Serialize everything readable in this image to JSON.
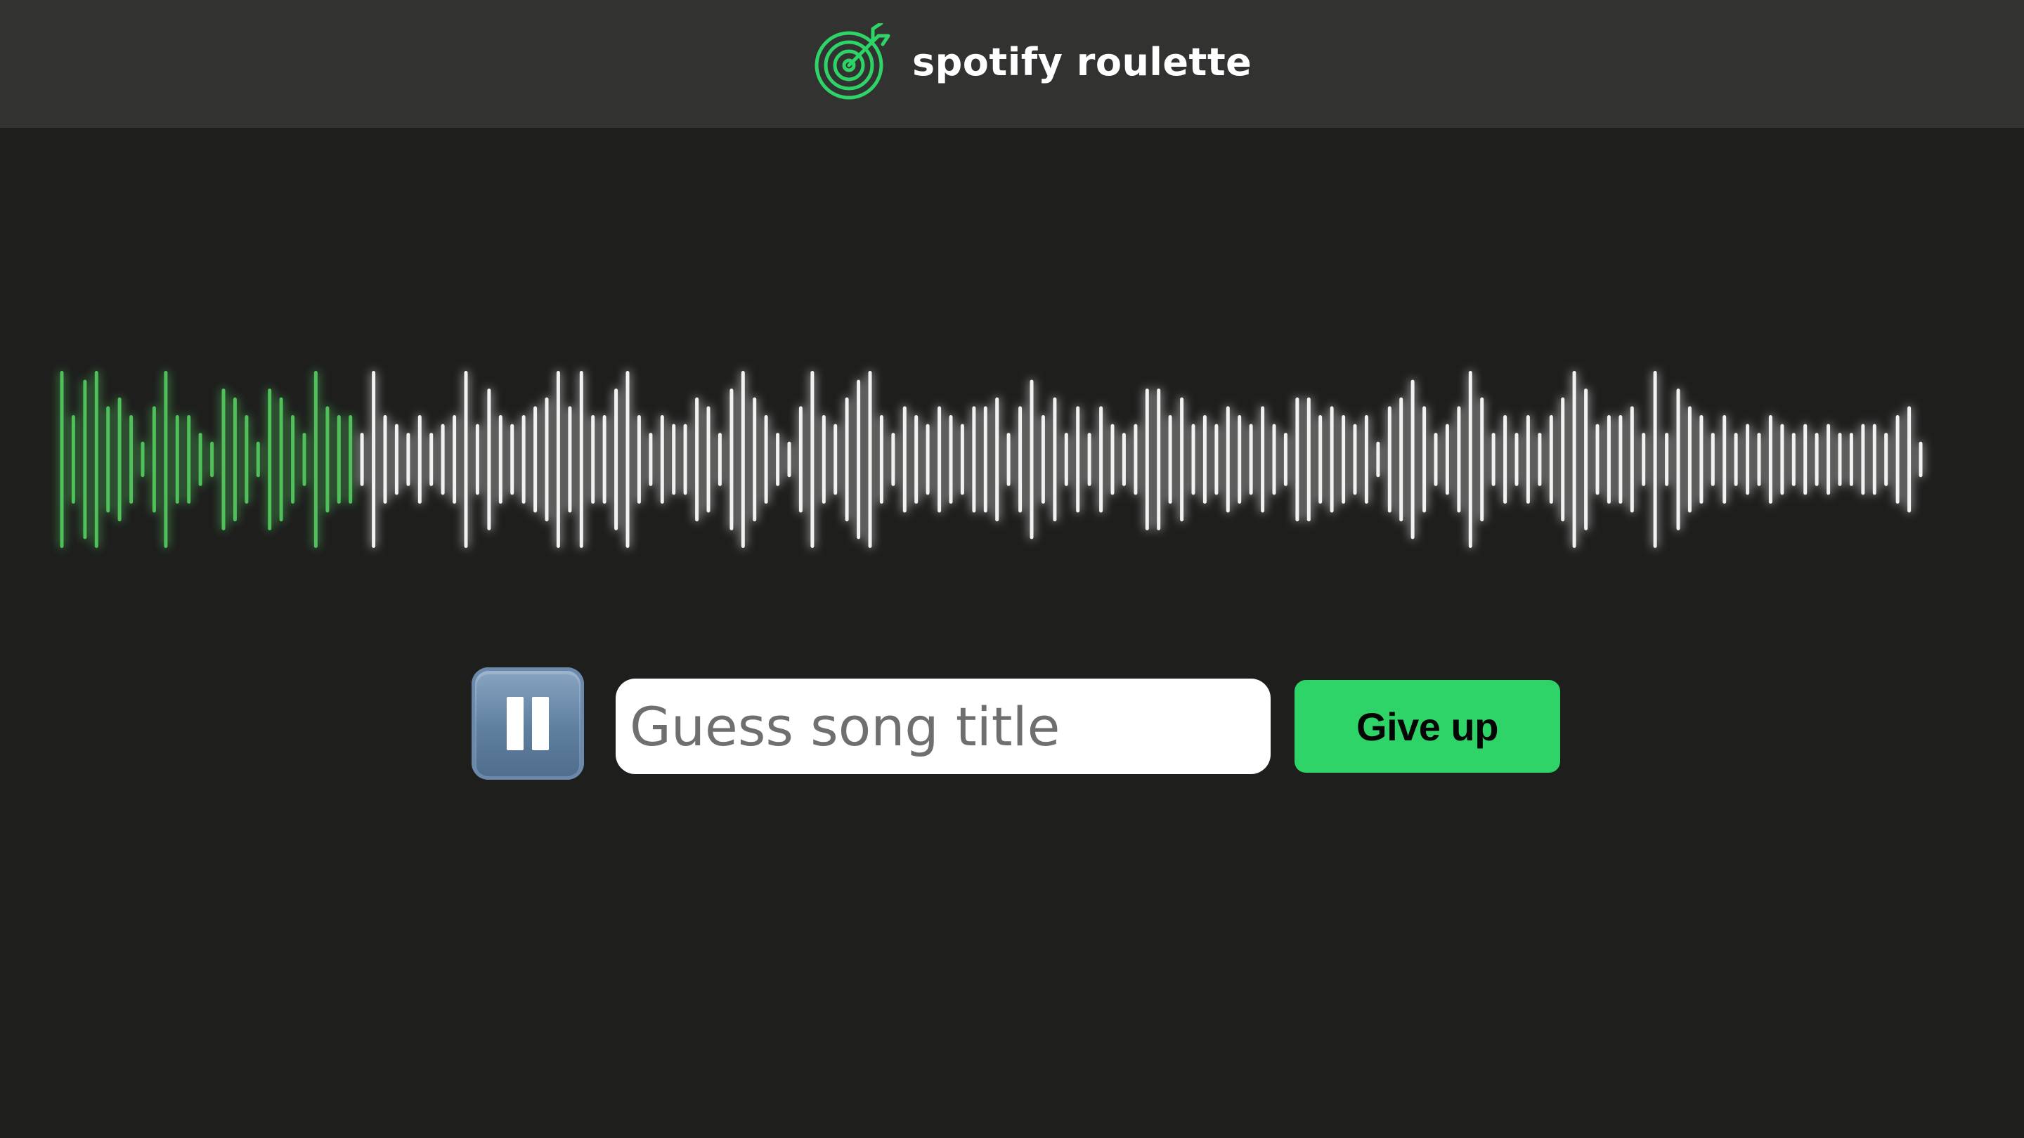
{
  "header": {
    "title": "spotify roulette",
    "logo_icon": "target-arrow-icon",
    "accent_color": "#2ed467"
  },
  "waveform": {
    "played_fraction": 0.16,
    "played_color": "#4fc05a",
    "unplayed_color": "#f2f2f2",
    "bar_levels": [
      1,
      0.5,
      0.9,
      1,
      0.6,
      0.7,
      0.5,
      0.2,
      0.6,
      1,
      0.5,
      0.5,
      0.3,
      0.2,
      0.8,
      0.7,
      0.5,
      0.2,
      0.8,
      0.7,
      0.5,
      0.3,
      1,
      0.6,
      0.5,
      0.5,
      0.3,
      1,
      0.5,
      0.4,
      0.3,
      0.5,
      0.3,
      0.4,
      0.5,
      1,
      0.4,
      0.8,
      0.5,
      0.4,
      0.5,
      0.6,
      0.7,
      1,
      0.6,
      1,
      0.5,
      0.5,
      0.8,
      1,
      0.5,
      0.3,
      0.5,
      0.4,
      0.4,
      0.7,
      0.6,
      0.3,
      0.8,
      1,
      0.7,
      0.5,
      0.3,
      0.2,
      0.6,
      1,
      0.5,
      0.4,
      0.7,
      0.9,
      1,
      0.5,
      0.3,
      0.6,
      0.5,
      0.4,
      0.6,
      0.5,
      0.4,
      0.6,
      0.6,
      0.7,
      0.3,
      0.6,
      0.9,
      0.5,
      0.7,
      0.3,
      0.6,
      0.3,
      0.6,
      0.4,
      0.3,
      0.4,
      0.8,
      0.8,
      0.5,
      0.7,
      0.4,
      0.5,
      0.4,
      0.6,
      0.5,
      0.4,
      0.6,
      0.4,
      0.3,
      0.7,
      0.7,
      0.5,
      0.6,
      0.5,
      0.4,
      0.5,
      0.2,
      0.6,
      0.7,
      0.9,
      0.6,
      0.3,
      0.4,
      0.6,
      1,
      0.7,
      0.3,
      0.5,
      0.3,
      0.5,
      0.3,
      0.5,
      0.7,
      1,
      0.8,
      0.4,
      0.5,
      0.5,
      0.6,
      0.3,
      1,
      0.3,
      0.8,
      0.6,
      0.5,
      0.3,
      0.5,
      0.3,
      0.4,
      0.3,
      0.5,
      0.4,
      0.3,
      0.4,
      0.3,
      0.4,
      0.3,
      0.3,
      0.4,
      0.4,
      0.3,
      0.5,
      0.6,
      0.2
    ]
  },
  "controls": {
    "pause_icon": "pause-icon",
    "guess_placeholder": "Guess song title",
    "guess_value": "",
    "give_up_label": "Give up"
  }
}
